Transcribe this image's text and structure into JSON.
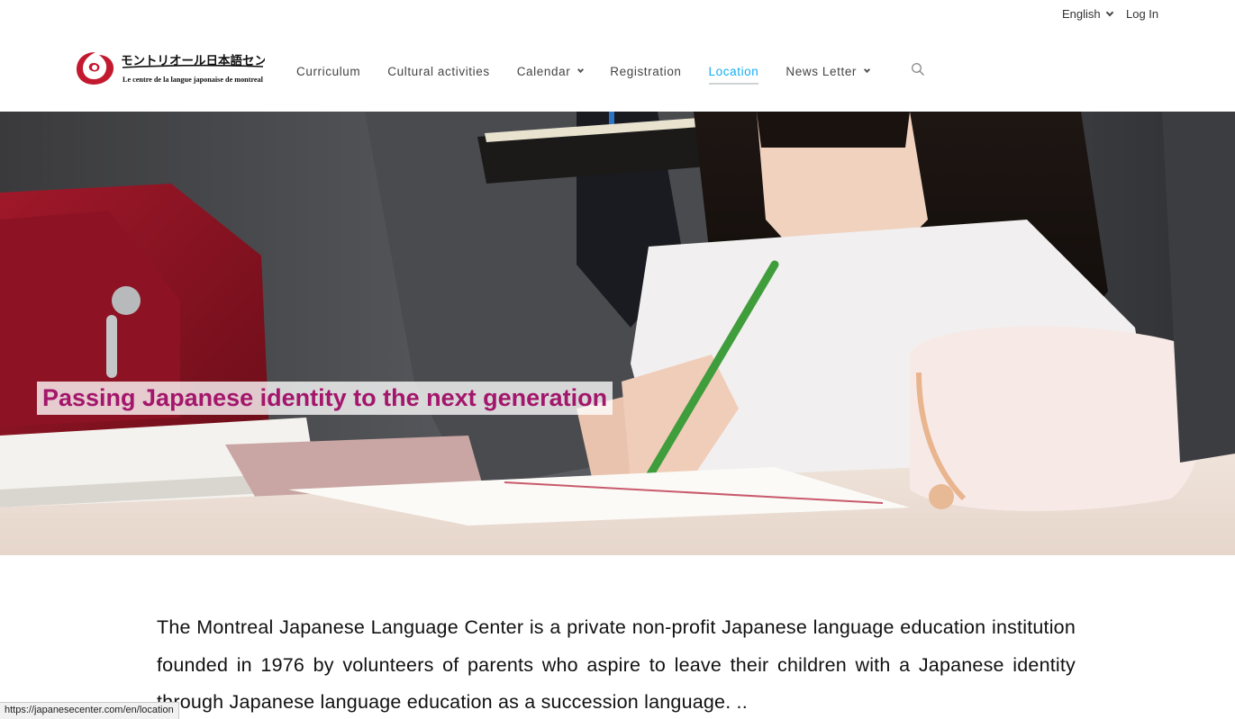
{
  "topbar": {
    "language": "English",
    "login": "Log In"
  },
  "logo": {
    "japanese_text": "モントリオール日本語センター",
    "subtitle": "Le centre de la langue japonaise de montreal",
    "brand_color": "#c3192f"
  },
  "nav": {
    "items": [
      {
        "label": "Curriculum"
      },
      {
        "label": "Cultural activities"
      },
      {
        "label": "Calendar"
      },
      {
        "label": "Registration"
      },
      {
        "label": "Location"
      },
      {
        "label": "News Letter"
      }
    ],
    "active": "Location",
    "accent_color": "#13aff0"
  },
  "hero": {
    "headline": "Passing Japanese identity to the next generation",
    "headline_color": "#a3166b"
  },
  "intro": {
    "text": "The Montreal Japanese Language Center is a private non-profit Japanese language education institution founded in 1976 by volunteers of parents who aspire to leave their children with a Japanese identity through Japanese language education as a succession language. .."
  },
  "status_bar": {
    "url": "https://japanesecenter.com/en/location"
  },
  "icons": [
    "chevron-down-icon",
    "search-icon",
    "logo-mark-icon"
  ]
}
